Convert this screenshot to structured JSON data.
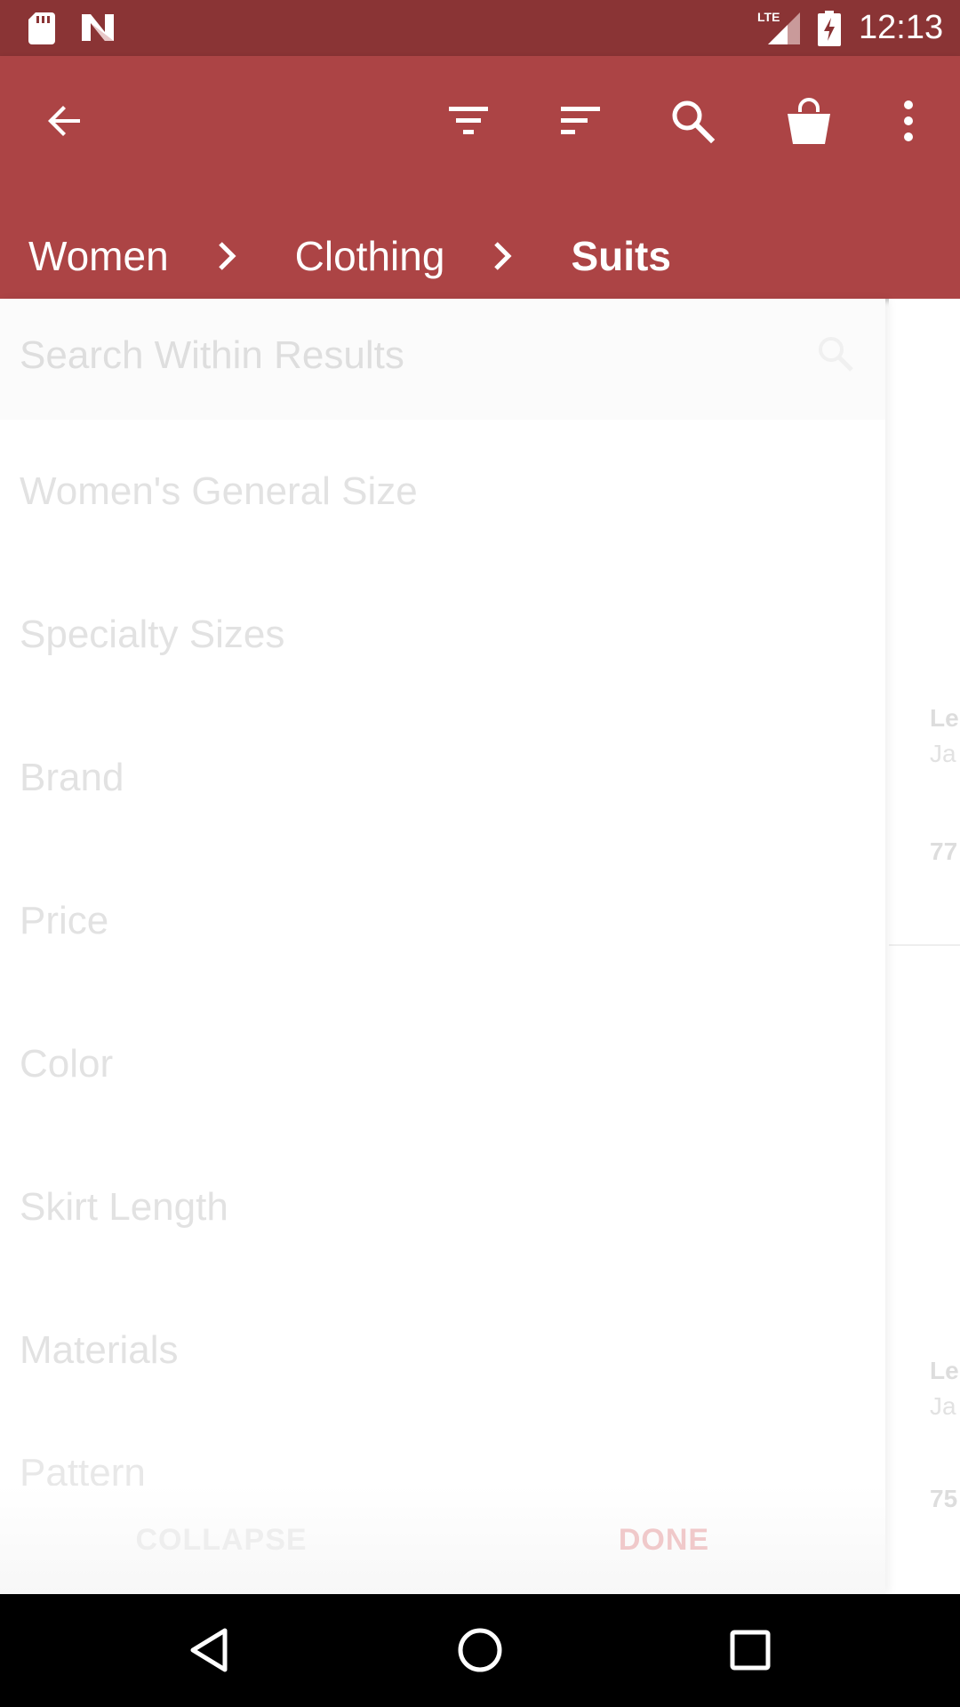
{
  "status_bar": {
    "time": "12:13",
    "network": "LTE",
    "icons": [
      "sd-card-icon",
      "n-icon",
      "lte-signal-icon",
      "battery-charging-icon"
    ]
  },
  "app_bar": {
    "icons": [
      "back-arrow-icon",
      "filter-icon",
      "sort-icon",
      "search-icon",
      "shopping-bag-icon",
      "more-vert-icon"
    ],
    "breadcrumb": [
      "Women",
      "Clothing",
      "Suits"
    ]
  },
  "filter_drawer": {
    "search_placeholder": "Search Within Results",
    "filters": [
      "Women's General Size",
      "Specialty Sizes",
      "Brand",
      "Price",
      "Color",
      "Skirt Length",
      "Materials",
      "Pattern"
    ],
    "collapse_label": "COLLAPSE",
    "done_label": "DONE"
  },
  "background_list": {
    "cards": [
      {
        "line1": "Le",
        "line2": "Ja",
        "line3": "77"
      },
      {
        "line1": "Le",
        "line2": "Ja",
        "line3": "75"
      }
    ]
  },
  "colors": {
    "status_bar": "#8a3435",
    "app_bar": "#ac4445",
    "done_accent": "#f0c9ca"
  }
}
